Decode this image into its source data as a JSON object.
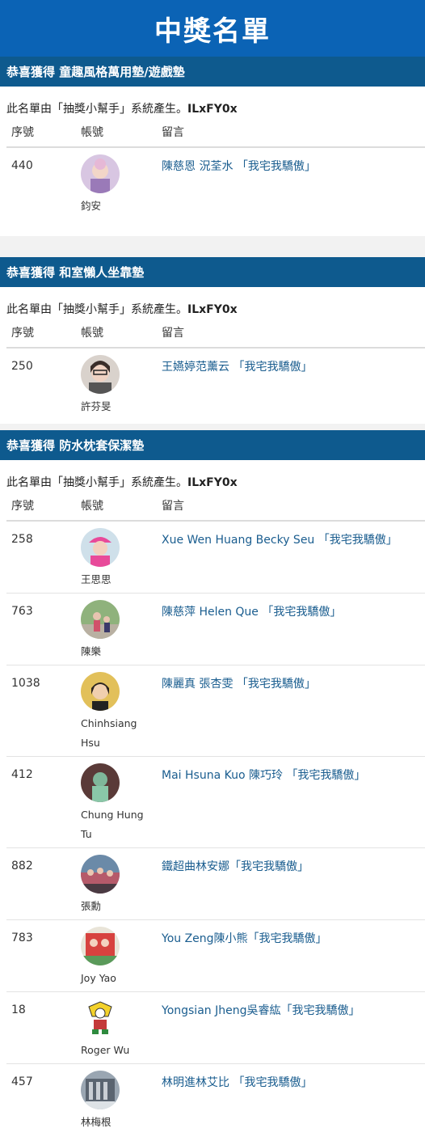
{
  "page": {
    "title": "中獎名單"
  },
  "sections": [
    {
      "title": "恭喜獲得 童趣風格萬用墊/遊戲墊",
      "note_prefix": "此名單由「抽獎小幫手」系統產生。",
      "note_code": "ILxFY0x",
      "headers": {
        "num": "序號",
        "account": "帳號",
        "message": "留言"
      },
      "rows": [
        {
          "num": "440",
          "name": "鈞安",
          "message": "陳慈恩 況荃水 「我宅我驕傲」",
          "avatar_color": "#c9a8d8"
        }
      ]
    },
    {
      "title": "恭喜獲得 和室懶人坐靠墊",
      "note_prefix": "此名單由「抽獎小幫手」系統產生。",
      "note_code": "ILxFY0x",
      "headers": {
        "num": "序號",
        "account": "帳號",
        "message": "留言"
      },
      "rows": [
        {
          "num": "250",
          "name": "許芬旻",
          "message": "王嬿婷范薰云 「我宅我驕傲」",
          "avatar_color": "#8a7a73"
        }
      ]
    },
    {
      "title": "恭喜獲得 防水枕套保潔墊",
      "note_prefix": "此名單由「抽獎小幫手」系統產生。",
      "note_code": "ILxFY0x",
      "headers": {
        "num": "序號",
        "account": "帳號",
        "message": "留言"
      },
      "rows": [
        {
          "num": "258",
          "name": "王思思",
          "message": "Xue Wen Huang Becky Seu 「我宅我驕傲」",
          "avatar_color": "#e26aa6"
        },
        {
          "num": "763",
          "name": "陳樂",
          "message": "陳慈萍 Helen Que 「我宅我驕傲」",
          "avatar_color": "#5f8a5a"
        },
        {
          "num": "1038",
          "name": "Chinhsiang Hsu",
          "message": "陳麗真 張杏雯 「我宅我驕傲」",
          "avatar_color": "#c4a24a"
        },
        {
          "num": "412",
          "name": "Chung Hung Tu",
          "message": "Mai Hsuna Kuo 陳巧玲 「我宅我驕傲」",
          "avatar_color": "#6b4a46"
        },
        {
          "num": "882",
          "name": "張勳",
          "message": "鐵超曲林安娜「我宅我驕傲」",
          "avatar_color": "#9a5a70"
        },
        {
          "num": "783",
          "name": "Joy Yao",
          "message": "You Zeng陳小熊「我宅我驕傲」",
          "avatar_color": "#c8443f"
        },
        {
          "num": "18",
          "name": "Roger Wu",
          "message": "Yongsian Jheng吳睿紘「我宅我驕傲」",
          "avatar_color": "#f1d12c"
        },
        {
          "num": "457",
          "name": "林梅根",
          "message": "林明進林艾比 「我宅我驕傲」",
          "avatar_color": "#7d8a96"
        }
      ]
    }
  ]
}
